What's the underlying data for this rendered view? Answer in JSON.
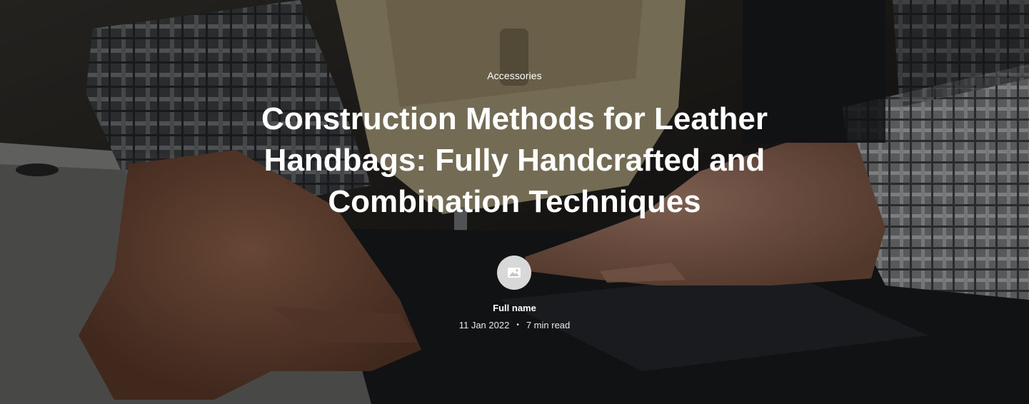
{
  "hero": {
    "background_image": "sewing-machine-hands-photo",
    "category": "Accessories",
    "title": "Construction Methods for Leather Handbags: Fully Handcrafted and Combination Techniques",
    "author": {
      "avatar_icon": "image-placeholder-icon",
      "name": "Full name"
    },
    "date": "11 Jan 2022",
    "separator": "•",
    "read_time": "7 min read"
  },
  "colors": {
    "text": "#ffffff",
    "overlay": "rgba(0,0,0,0.42)",
    "avatar_bg": "#d8d8d8"
  }
}
